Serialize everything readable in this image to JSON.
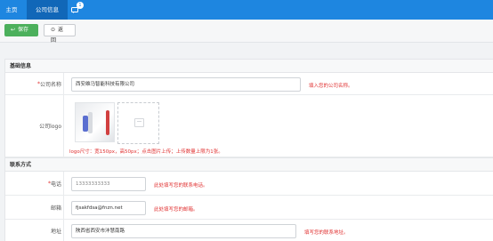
{
  "tabs": {
    "home": "主页",
    "company_info": "公司信息",
    "message_badge": "1"
  },
  "toolbar": {
    "save_label": "保存",
    "back_label": "返回"
  },
  "sections": {
    "basic": "基础信息",
    "contact": "联系方式"
  },
  "form": {
    "company_name": {
      "required_mark": "*",
      "label": "公司名称",
      "value": "西安维马智能科技有限公司",
      "hint": "填入您的公司名称。"
    },
    "logo": {
      "label": "公司logo",
      "hint": "logo尺寸：宽150px，高50px；点击图片上传；上传数量上限为1张。"
    },
    "phone": {
      "required_mark": "*",
      "label": "电话",
      "value": "13333333333",
      "hint": "此处填写您的联系电话。"
    },
    "email": {
      "label": "邮箱",
      "value": "fjsakfdsa@fnzn.net",
      "hint": "此处填写您的邮箱。"
    },
    "address": {
      "label": "地址",
      "value": "陕西省西安市沣慧南路",
      "hint": "填写您的联系地址。"
    }
  }
}
